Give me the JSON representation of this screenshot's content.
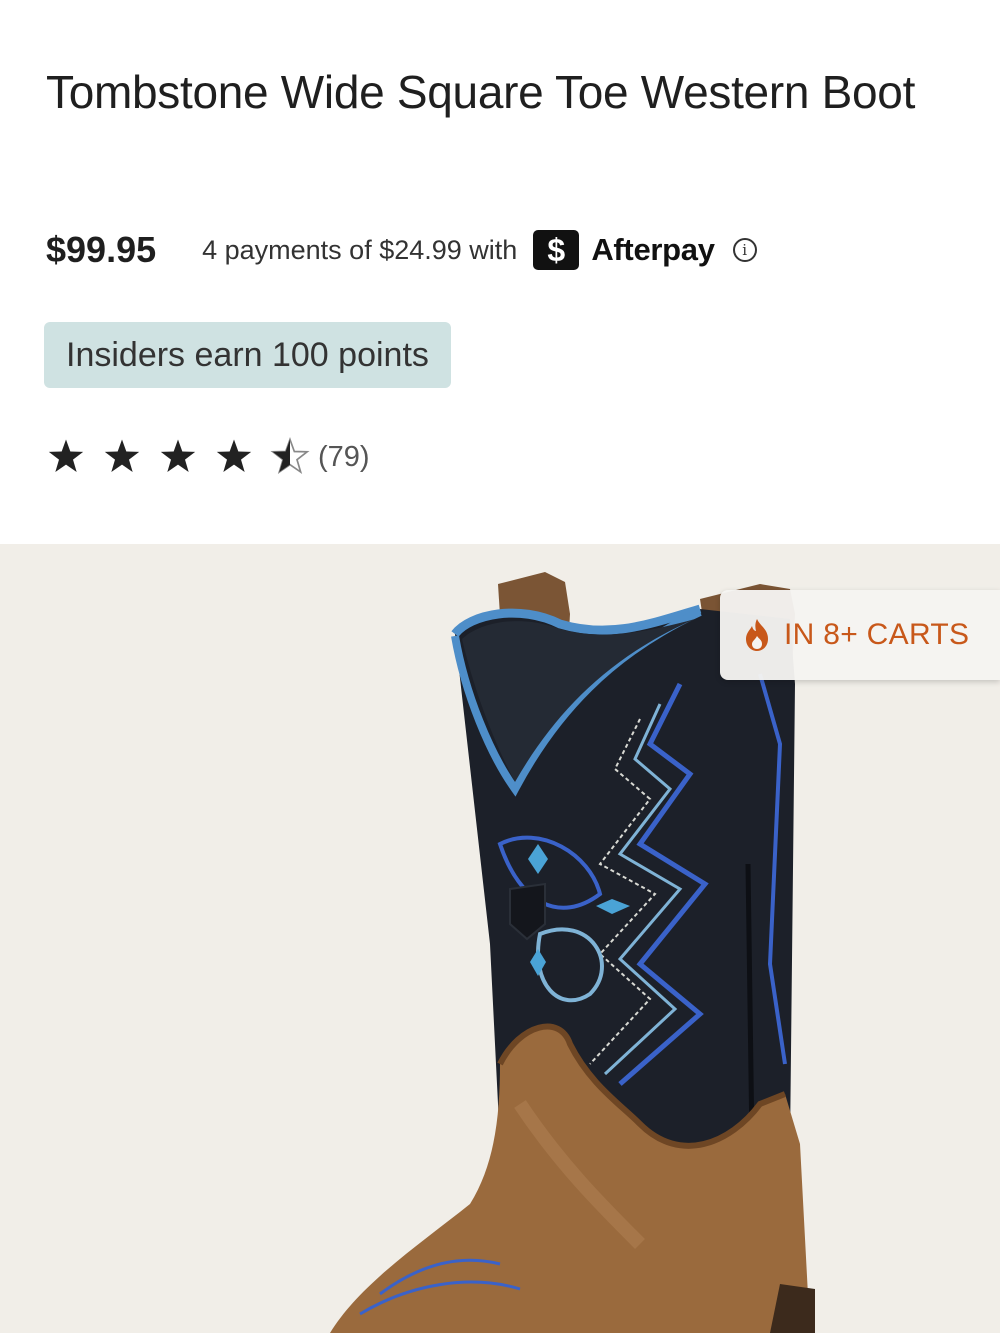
{
  "product": {
    "title": "Tombstone Wide Square Toe Western Boot",
    "price": "$99.95",
    "installment_text": "4 payments of $24.99 with",
    "installment_provider": "Afterpay",
    "provider_badge_symbol": "$",
    "info_symbol": "i",
    "insiders_badge": "Insiders earn 100 points",
    "rating": {
      "value": 4.5,
      "max": 5,
      "count_label": "(79)"
    }
  },
  "hero": {
    "badge_icon": "flame-icon",
    "badge_text": "IN 8+ CARTS"
  },
  "colors": {
    "insider_bg": "#cfe2e2",
    "hero_bg": "#f1eee8",
    "cart_badge_text": "#c8581a"
  }
}
